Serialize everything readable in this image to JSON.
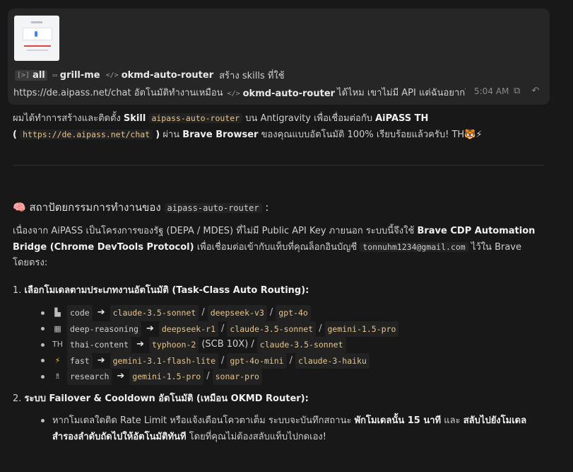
{
  "user_message": {
    "chips": [
      {
        "label": "all",
        "icon": "ai-icon"
      },
      {
        "label": "grill-me",
        "icon": "chat-icon"
      },
      {
        "label": "okmd-auto-router",
        "icon": "code-icon"
      }
    ],
    "line1_tail": "สร้าง skills ที่ใช้",
    "line2_pre": "https://de.aipass.net/chat อัตโนมัติทำงานเหมือน",
    "line2_chip": "okmd-auto-router",
    "line2_post": "ได้ไหม เขาไม่มี API แต่ฉันอยากใช้ผ่า",
    "time": "5:04 AM",
    "copy_icon": "copy-icon",
    "undo_icon": "undo-icon"
  },
  "response": {
    "intro": {
      "t1": "ผมได้ทำการสร้างและติดตั้ง",
      "t2": "Skill",
      "t3": "aipass-auto-router",
      "t4": "บน Antigravity เพื่อเชื่อมต่อกับ",
      "t5": "AiPASS TH",
      "t6": "(",
      "t7": "https://de.aipass.net/chat",
      "t8": ")",
      "t9": "ผ่าน",
      "t10": "Brave Browser",
      "t11": "ของคุณแบบอัตโนมัติ 100% เรียบร้อยแล้วครับ! TH🐯⚡"
    },
    "heading": {
      "emoji": "🧠",
      "text": "สถาปัตยกรรมการทำงานของ",
      "code": "aipass-auto-router",
      "colon": ":"
    },
    "para": {
      "t1": "เนื่องจาก AiPASS เป็นโครงการของรัฐ (DEPA / MDES) ที่ไม่มี Public API Key ภายนอก ระบบนี้จึงใช้",
      "t2": "Brave CDP Automation Bridge (Chrome DevTools Protocol)",
      "t3": "เพื่อเชื่อมต่อเข้ากับแท็บที่คุณล็อกอินบัญชี",
      "t4": "tonnuhm1234@gmail.com",
      "t5": "ไว้ใน Brave โดยตรง:"
    },
    "ol1": {
      "num": "1.",
      "text": "เลือกโมเดลตามประเภทงานอัตโนมัติ (Task-Class Auto Routing):"
    },
    "routes": [
      {
        "icon": "monitor-icon",
        "glyph": "▙",
        "name": "code",
        "models": [
          "claude-3.5-sonnet",
          "deepseek-v3",
          "gpt-4o"
        ]
      },
      {
        "icon": "dots-icon",
        "glyph": "▦",
        "name": "deep-reasoning",
        "models": [
          "deepseek-r1",
          "claude-3.5-sonnet",
          "gemini-1.5-pro"
        ]
      },
      {
        "icon": "th-flag-icon",
        "glyph": "TH",
        "name": "thai-content",
        "models": [
          "typhoon-2"
        ],
        "note": "(SCB 10X) /",
        "models2": [
          "claude-3.5-sonnet"
        ]
      },
      {
        "icon": "lightning-icon",
        "glyph": "⚡",
        "name": "fast",
        "models": [
          "gemini-3.1-flash-lite",
          "gpt-4o-mini",
          "claude-3-haiku"
        ]
      },
      {
        "icon": "research-icon",
        "glyph": "♗",
        "name": "research",
        "models": [
          "gemini-1.5-pro",
          "sonar-pro"
        ]
      }
    ],
    "ol2": {
      "num": "2.",
      "text": "ระบบ Failover & Cooldown อัตโนมัติ (เหมือน OKMD Router):"
    },
    "failover": {
      "t1": "หากโมเดลใดติด Rate Limit หรือแจ้งเตือนโควตาเต็ม ระบบจะบันทึกสถานะ",
      "t2": "พักโมเดลนั้น 15 นาที",
      "t3": "และ",
      "t4": "สลับไปยังโมเดลสำรองลำดับถัดไปให้อัตโนมัติทันที",
      "t5": "โดยที่คุณไม่ต้องสลับแท็บไปกดเอง!"
    }
  },
  "colors": {
    "background": "#181818",
    "card": "#262626",
    "code_text": "#e8c58a"
  }
}
